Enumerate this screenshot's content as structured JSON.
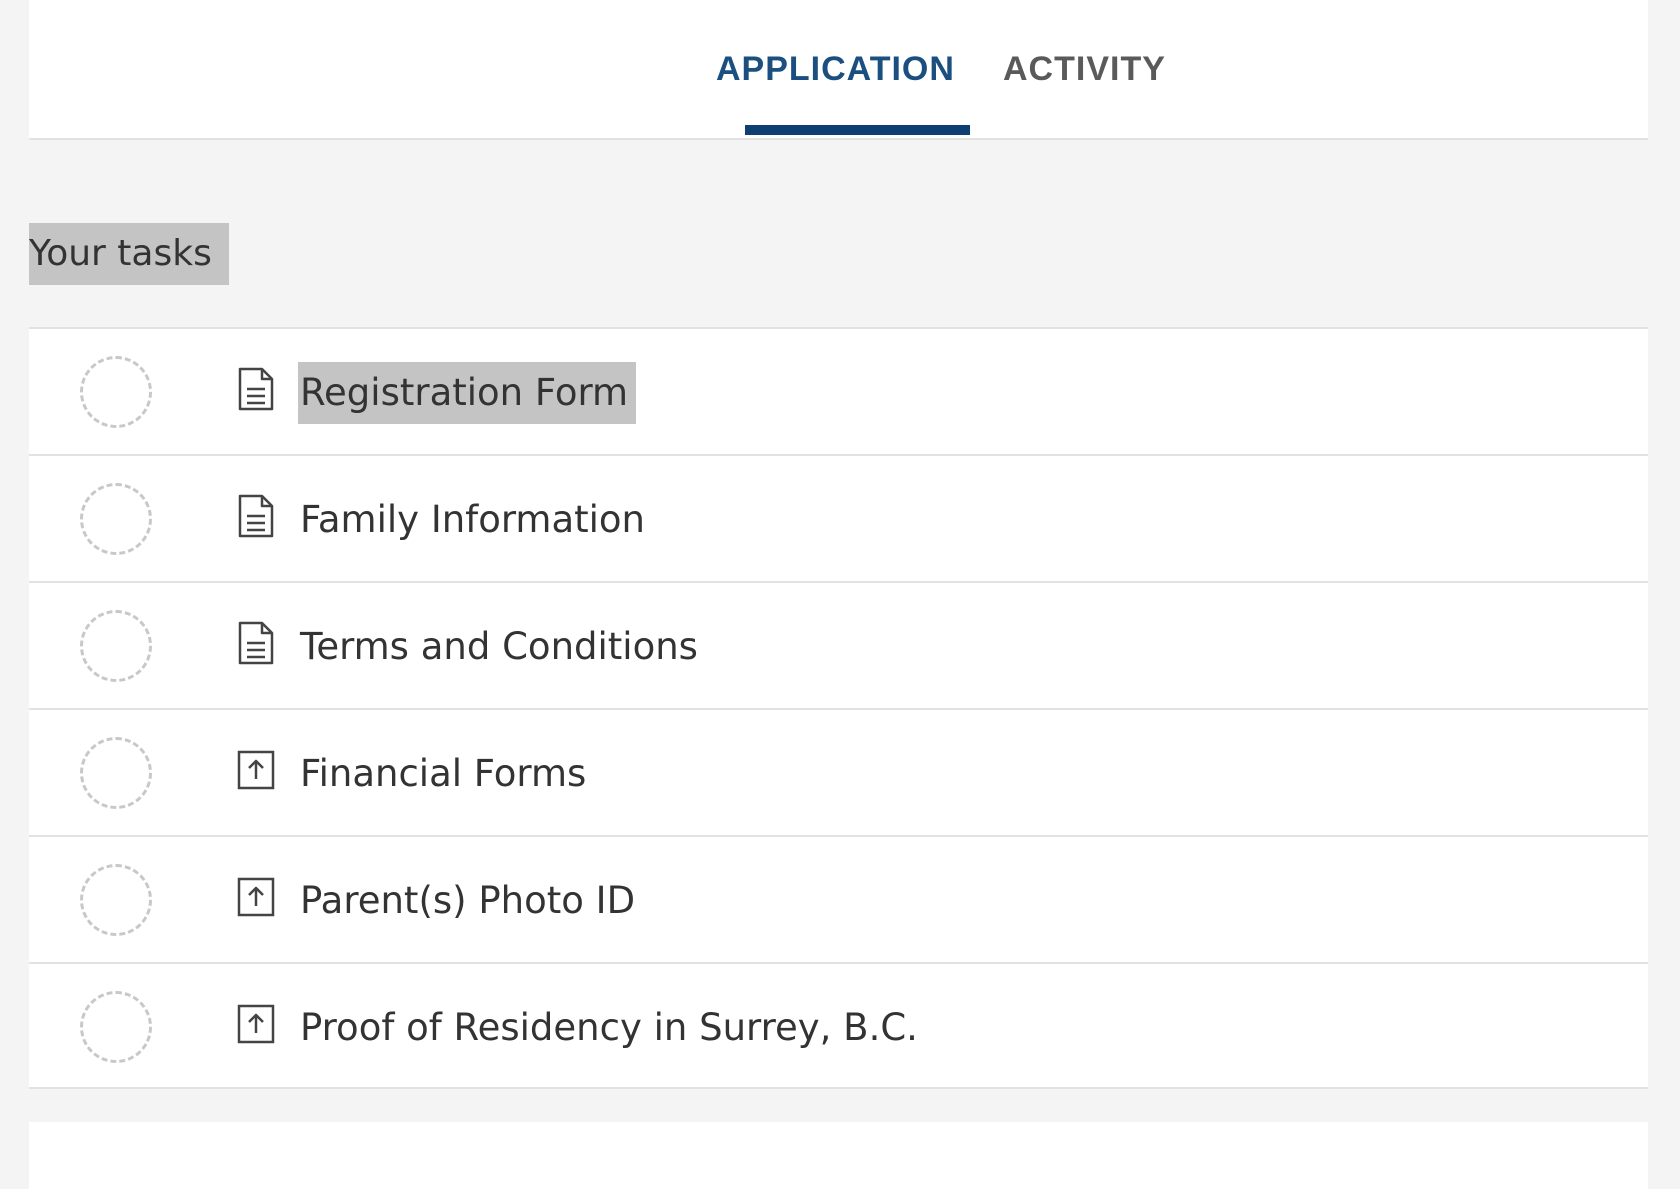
{
  "tabs": [
    {
      "label": "APPLICATION",
      "active": true
    },
    {
      "label": "ACTIVITY",
      "active": false
    }
  ],
  "colors": {
    "active_tab": "#1b4f80",
    "tab_underline": "#0d3f73",
    "inactive_tab": "#5a5a5a",
    "highlight": "#c4c4c4"
  },
  "section": {
    "title": "Your tasks"
  },
  "tasks": [
    {
      "label": "Registration Form",
      "icon": "document-icon",
      "status": "incomplete"
    },
    {
      "label": "Family Information",
      "icon": "document-icon",
      "status": "incomplete"
    },
    {
      "label": "Terms and Conditions",
      "icon": "document-icon",
      "status": "incomplete"
    },
    {
      "label": "Financial Forms",
      "icon": "upload-icon",
      "status": "incomplete"
    },
    {
      "label": "Parent(s) Photo ID",
      "icon": "upload-icon",
      "status": "incomplete"
    },
    {
      "label": "Proof of Residency in Surrey, B.C.",
      "icon": "upload-icon",
      "status": "incomplete"
    }
  ]
}
